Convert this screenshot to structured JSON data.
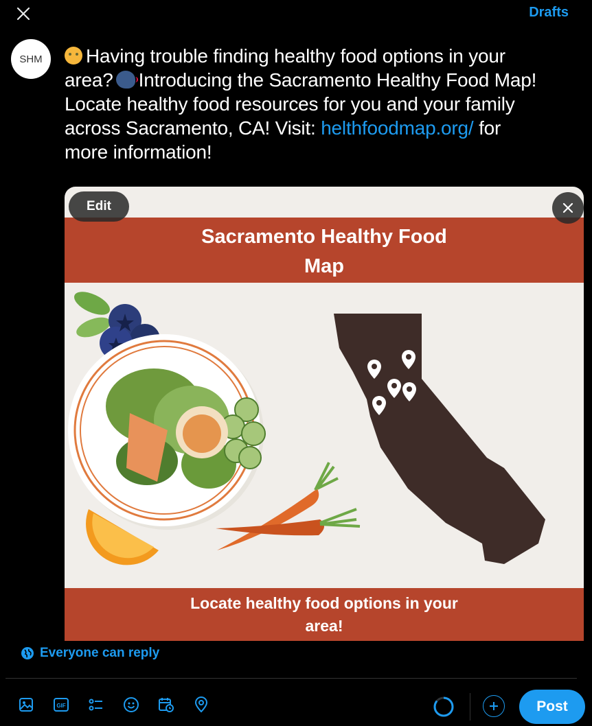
{
  "header": {
    "close_icon": "close-icon",
    "drafts_label": "Drafts"
  },
  "avatar": {
    "initials": "SHM"
  },
  "tweet": {
    "line1": "Having trouble finding healthy food options in your",
    "line2_pre": "area?",
    "line2_post": "Introducing the Sacramento Healthy Food Map!",
    "line3": "Locate healthy food resources for you and your family",
    "line4_pre": "across Sacramento, CA! Visit: ",
    "link": "helthfoodmap.org/",
    "line4_post": " for",
    "line5": "more information!",
    "emoji_1": "thinking-face-emoji",
    "emoji_2": "speaking-head-emoji"
  },
  "media": {
    "edit_label": "Edit",
    "title_line1": "Sacramento Healthy Food",
    "title_line2": "Map",
    "caption_line1": "Locate healthy food options in your",
    "caption_line2": "area!",
    "band_color": "#b6452c",
    "map_color": "#3e2c28"
  },
  "reply_setting": {
    "label": "Everyone can reply"
  },
  "toolbar": {
    "icons": [
      "image-icon",
      "gif-icon",
      "poll-icon",
      "emoji-icon",
      "schedule-icon",
      "location-icon"
    ]
  },
  "post_label": "Post",
  "colors": {
    "accent": "#1d9bf0",
    "background": "#000000"
  }
}
